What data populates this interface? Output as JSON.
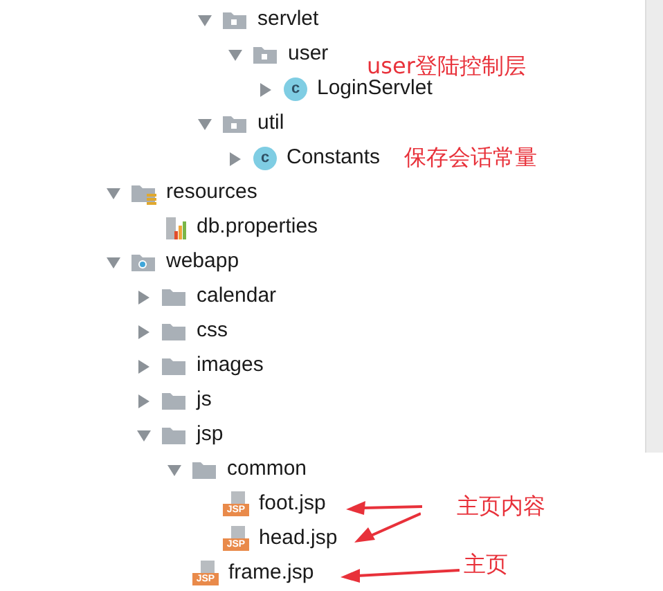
{
  "tree": [
    {
      "children": [
        {
          "children": [
            {
              "children": [
                {
                  "label": "servlet",
                  "kind": "package",
                  "expanded": true,
                  "children": [
                    {
                      "label": "user",
                      "kind": "package",
                      "expanded": true,
                      "children": [
                        {
                          "label": "LoginServlet",
                          "kind": "class",
                          "badge": "c",
                          "expanded": false
                        }
                      ]
                    }
                  ]
                },
                {
                  "label": "util",
                  "kind": "package",
                  "expanded": true,
                  "children": [
                    {
                      "label": "Constants",
                      "kind": "class",
                      "badge": "c",
                      "expanded": false
                    }
                  ]
                }
              ]
            }
          ]
        }
      ]
    },
    {
      "label": "resources",
      "kind": "resources",
      "expanded": true,
      "children": [
        {
          "label": "db.properties",
          "kind": "properties"
        }
      ]
    },
    {
      "label": "webapp",
      "kind": "webroot",
      "expanded": true,
      "children": [
        {
          "label": "calendar",
          "kind": "folder",
          "expanded": false
        },
        {
          "label": "css",
          "kind": "folder",
          "expanded": false
        },
        {
          "label": "images",
          "kind": "folder",
          "expanded": false
        },
        {
          "label": "js",
          "kind": "folder",
          "expanded": false
        },
        {
          "label": "jsp",
          "kind": "folder",
          "expanded": true,
          "children": [
            {
              "label": "common",
              "kind": "folder",
              "expanded": true,
              "children": [
                {
                  "label": "foot.jsp",
                  "kind": "jsp",
                  "badge": "JSP"
                },
                {
                  "label": "head.jsp",
                  "kind": "jsp",
                  "badge": "JSP"
                }
              ]
            },
            {
              "label": "frame.jsp",
              "kind": "jsp",
              "badge": "JSP"
            }
          ]
        }
      ]
    }
  ],
  "annotations": [
    {
      "text": "user登陆控制层"
    },
    {
      "text": "保存会话常量"
    },
    {
      "text": "主页内容"
    },
    {
      "text": "主页"
    }
  ]
}
